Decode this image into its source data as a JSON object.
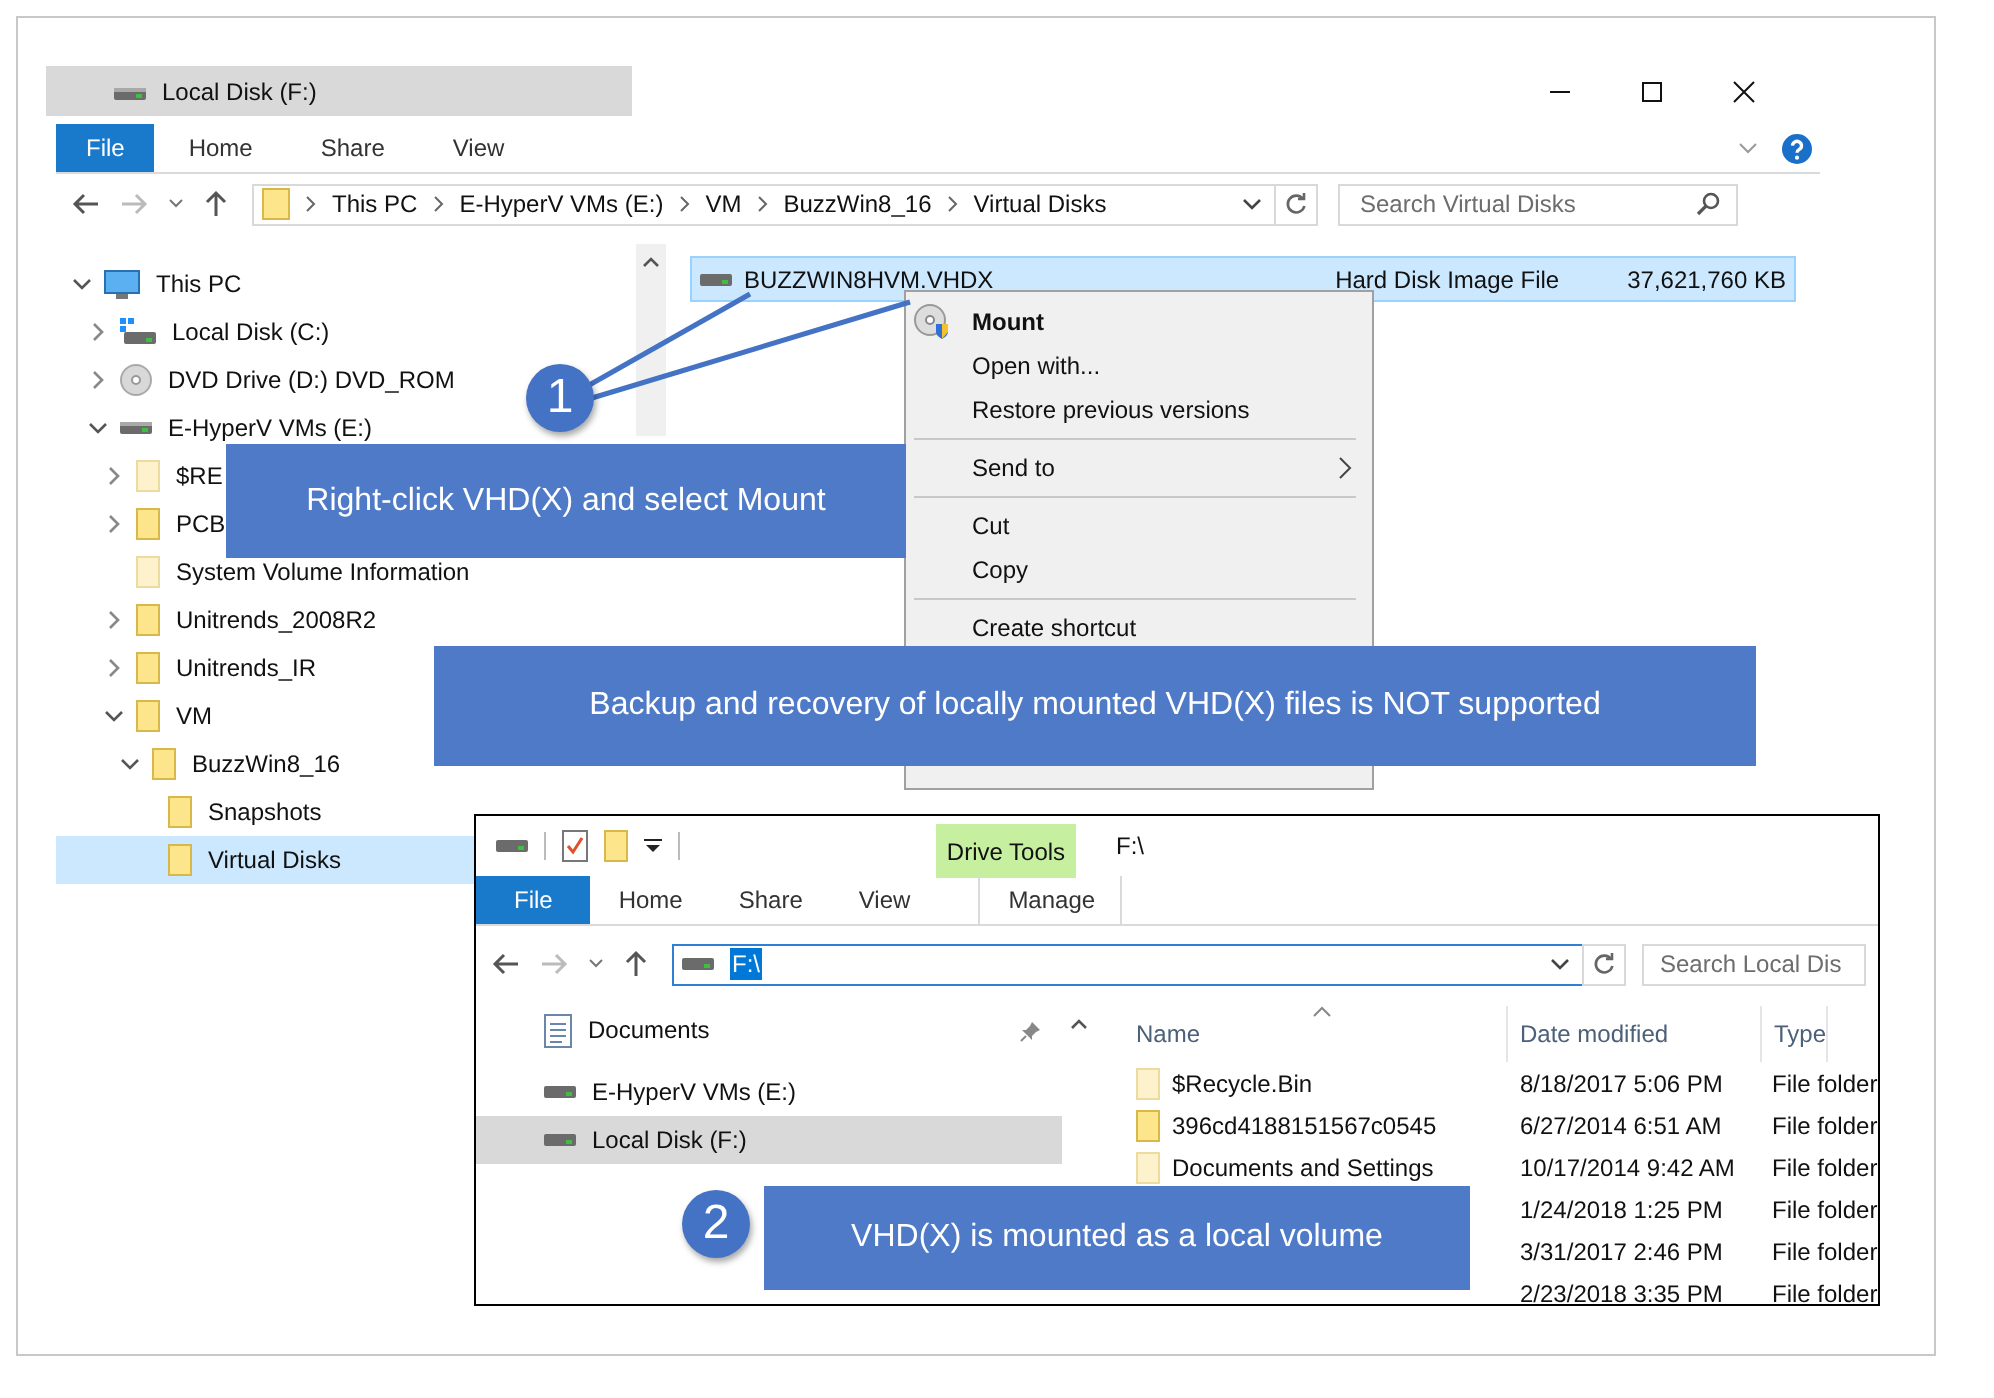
{
  "main_window": {
    "title": "Local Disk (F:)",
    "ribbon_tabs": [
      {
        "label": "File",
        "kind": "file"
      },
      {
        "label": "Home",
        "kind": "tab"
      },
      {
        "label": "Share",
        "kind": "tab"
      },
      {
        "label": "View",
        "kind": "tab"
      }
    ],
    "breadcrumb": [
      "This PC",
      "E-HyperV VMs (E:)",
      "VM",
      "BuzzWin8_16",
      "Virtual Disks"
    ],
    "search": {
      "placeholder": "Search Virtual Disks"
    },
    "tree": [
      {
        "label": "This PC",
        "kind": "pc",
        "expandable": true,
        "expanded": true,
        "selected": false,
        "children": [
          {
            "label": "Local Disk (C:)",
            "kind": "system-drive",
            "expandable": true,
            "expanded": false,
            "selected": false
          },
          {
            "label": "DVD Drive (D:) DVD_ROM",
            "kind": "disc",
            "expandable": true,
            "expanded": false,
            "selected": false
          },
          {
            "label": "E-HyperV VMs (E:)",
            "kind": "drive",
            "expandable": true,
            "expanded": true,
            "selected": false,
            "children": [
              {
                "label": "$RE",
                "kind": "hidden-folder",
                "expandable": true,
                "expanded": false,
                "selected": false
              },
              {
                "label": "PCB",
                "kind": "folder",
                "expandable": true,
                "expanded": false,
                "selected": false
              },
              {
                "label": "System Volume Information",
                "kind": "hidden-folder",
                "expandable": false,
                "expanded": false,
                "selected": false
              },
              {
                "label": "Unitrends_2008R2",
                "kind": "folder",
                "expandable": true,
                "expanded": false,
                "selected": false
              },
              {
                "label": "Unitrends_IR",
                "kind": "folder",
                "expandable": true,
                "expanded": false,
                "selected": false
              },
              {
                "label": "VM",
                "kind": "folder",
                "expandable": true,
                "expanded": true,
                "selected": false,
                "children": [
                  {
                    "label": "BuzzWin8_16",
                    "kind": "folder",
                    "expandable": true,
                    "expanded": true,
                    "selected": false,
                    "children": [
                      {
                        "label": "Snapshots",
                        "kind": "folder",
                        "expandable": false,
                        "expanded": false,
                        "selected": false
                      },
                      {
                        "label": "Virtual Disks",
                        "kind": "folder",
                        "expandable": false,
                        "expanded": false,
                        "selected": true
                      }
                    ]
                  }
                ]
              }
            ]
          }
        ]
      }
    ],
    "files": [
      {
        "name": "BUZZWIN8HVM.VHDX",
        "type": "Hard Disk Image File",
        "size": "37,621,760 KB",
        "selected": true
      }
    ],
    "context_menu": [
      {
        "label": "Mount",
        "kind": "default"
      },
      {
        "label": "Open with...",
        "kind": "item"
      },
      {
        "label": "Restore previous versions",
        "kind": "item"
      },
      {
        "kind": "separator"
      },
      {
        "label": "Send to",
        "kind": "submenu"
      },
      {
        "kind": "separator"
      },
      {
        "label": "Cut",
        "kind": "item"
      },
      {
        "label": "Copy",
        "kind": "item"
      },
      {
        "kind": "separator"
      },
      {
        "label": "Create shortcut",
        "kind": "item"
      }
    ]
  },
  "second_window": {
    "context_tab": "Drive Tools",
    "title": "F:\\",
    "ribbon_tabs": [
      {
        "label": "File",
        "kind": "file"
      },
      {
        "label": "Home",
        "kind": "tab"
      },
      {
        "label": "Share",
        "kind": "tab"
      },
      {
        "label": "View",
        "kind": "tab"
      },
      {
        "label": "Manage",
        "kind": "context"
      }
    ],
    "address": {
      "value": "F:\\",
      "highlighted": true
    },
    "search": {
      "placeholder": "Search Local Dis"
    },
    "nav": [
      {
        "label": "Documents",
        "kind": "documents",
        "pinned": true,
        "selected": false
      },
      {
        "label": "E-HyperV VMs (E:)",
        "kind": "drive",
        "pinned": false,
        "selected": false
      },
      {
        "label": "Local Disk (F:)",
        "kind": "drive",
        "pinned": false,
        "selected": true
      }
    ],
    "columns": [
      "Name",
      "Date modified",
      "Type"
    ],
    "rows": [
      {
        "name": "$Recycle.Bin",
        "kind": "hidden-folder",
        "date": "8/18/2017 5:06 PM",
        "type": "File folder"
      },
      {
        "name": "396cd4188151567c0545",
        "kind": "folder",
        "date": "6/27/2014 6:51 AM",
        "type": "File folder"
      },
      {
        "name": "Documents and Settings",
        "kind": "link",
        "date": "10/17/2014 9:42 AM",
        "type": "File folder"
      },
      {
        "date": "1/24/2018 1:25 PM",
        "type": "File folder"
      },
      {
        "date": "3/31/2017 2:46 PM",
        "type": "File folder"
      },
      {
        "date": "2/23/2018 3:35 PM",
        "type": "File folder"
      }
    ]
  },
  "callouts": [
    {
      "kind": "step",
      "number": "1",
      "text": "Right-click VHD(X) and select Mount"
    },
    {
      "kind": "note",
      "text": "Backup and recovery of locally mounted VHD(X) files is NOT supported"
    },
    {
      "kind": "step",
      "number": "2",
      "text": "VHD(X) is mounted as a local volume"
    }
  ]
}
